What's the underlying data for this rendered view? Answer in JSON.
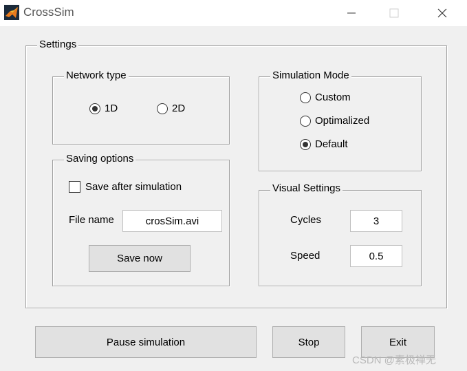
{
  "window": {
    "title": "CrossSim",
    "controls": {
      "minimize": "—",
      "maximize": "☐",
      "close": "✕"
    }
  },
  "settings": {
    "legend": "Settings",
    "network_type": {
      "legend": "Network type",
      "options": [
        {
          "label": "1D",
          "selected": true
        },
        {
          "label": "2D",
          "selected": false
        }
      ]
    },
    "simulation_mode": {
      "legend": "Simulation Mode",
      "options": [
        {
          "label": "Custom",
          "selected": false
        },
        {
          "label": "Optimalized",
          "selected": false
        },
        {
          "label": "Default",
          "selected": true
        }
      ]
    },
    "saving_options": {
      "legend": "Saving options",
      "save_after_label": "Save after simulation",
      "save_after_checked": false,
      "file_name_label": "File name",
      "file_name_value": "crosSim.avi",
      "save_now_label": "Save now"
    },
    "visual_settings": {
      "legend": "Visual Settings",
      "cycles_label": "Cycles",
      "cycles_value": "3",
      "speed_label": "Speed",
      "speed_value": "0.5"
    }
  },
  "actions": {
    "pause_label": "Pause simulation",
    "stop_label": "Stop",
    "exit_label": "Exit"
  },
  "watermark": "CSDN @素极禅无",
  "colors": {
    "titlebar": "#ffffff",
    "window_bg": "#f0f0f0",
    "button_bg": "#e1e1e1",
    "border": "#a0a0a0"
  }
}
